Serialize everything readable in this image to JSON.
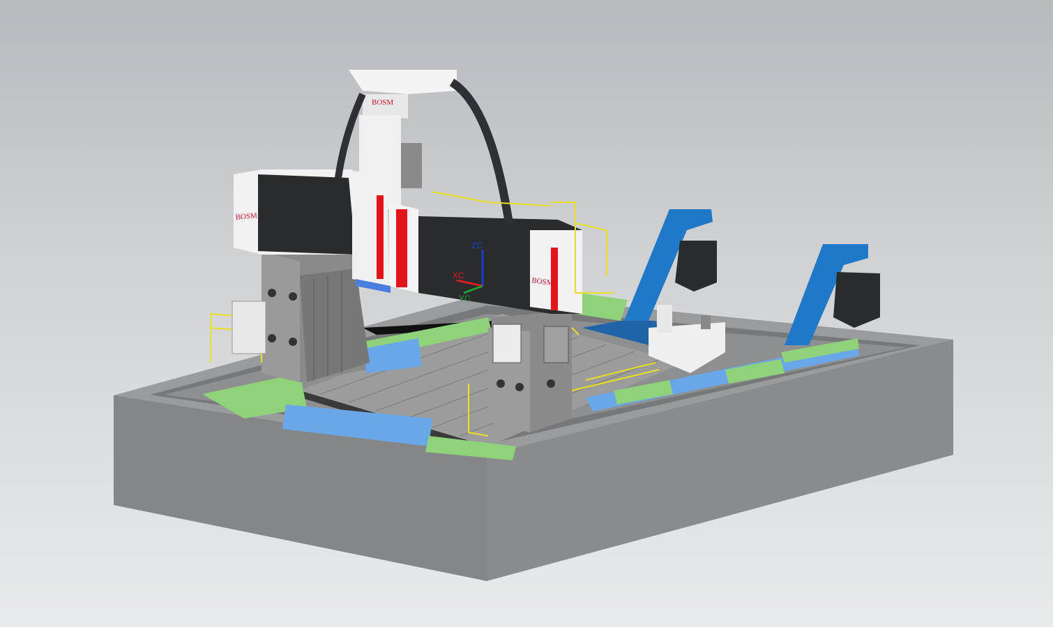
{
  "viewport": {
    "background_top": "#b7b9bc",
    "background_bottom": "#e9eaeb"
  },
  "machine": {
    "brand_labels": [
      "BOSM",
      "BOSM",
      "BOSM"
    ],
    "accent_color": "#e3141b",
    "guard_color": "#2a2b2d",
    "conveyor_color": "#1f78c8",
    "railing_color": "#e8e020"
  },
  "csys": {
    "zc": "ZC",
    "xc": "XC",
    "yc": "YC",
    "zc_color": "#1b3ccf",
    "xc_color": "#d42020",
    "yc_color": "#20a030"
  }
}
